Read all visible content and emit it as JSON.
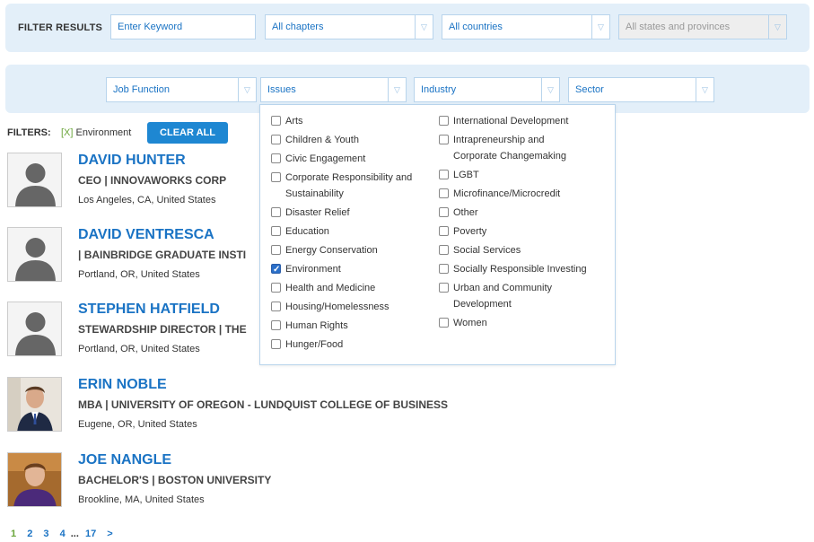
{
  "filter_bar": {
    "label": "FILTER RESULTS",
    "keyword_placeholder": "Enter Keyword",
    "chapters": "All chapters",
    "countries": "All countries",
    "states": "All states and provinces"
  },
  "sub_filters": {
    "job_function": "Job Function",
    "issues": "Issues",
    "industry": "Industry",
    "sector": "Sector"
  },
  "issues_options_left": [
    {
      "label": "Arts",
      "checked": false
    },
    {
      "label": "Children & Youth",
      "checked": false
    },
    {
      "label": "Civic Engagement",
      "checked": false
    },
    {
      "label": "Corporate Responsibility and Sustainability",
      "checked": false
    },
    {
      "label": "Disaster Relief",
      "checked": false
    },
    {
      "label": "Education",
      "checked": false
    },
    {
      "label": "Energy Conservation",
      "checked": false
    },
    {
      "label": "Environment",
      "checked": true
    },
    {
      "label": "Health and Medicine",
      "checked": false
    },
    {
      "label": "Housing/Homelessness",
      "checked": false
    },
    {
      "label": "Human Rights",
      "checked": false
    },
    {
      "label": "Hunger/Food",
      "checked": false
    }
  ],
  "issues_options_right": [
    {
      "label": "International Development",
      "checked": false
    },
    {
      "label": "Intrapreneurship and Corporate Changemaking",
      "checked": false
    },
    {
      "label": "LGBT",
      "checked": false
    },
    {
      "label": "Microfinance/Microcredit",
      "checked": false
    },
    {
      "label": "Other",
      "checked": false
    },
    {
      "label": "Poverty",
      "checked": false
    },
    {
      "label": "Social Services",
      "checked": false
    },
    {
      "label": "Socially Responsible Investing",
      "checked": false
    },
    {
      "label": "Urban and Community Development",
      "checked": false
    },
    {
      "label": "Women",
      "checked": false
    }
  ],
  "active_filters": {
    "label": "FILTERS:",
    "x_mark": "[X]",
    "item": "Environment",
    "clear_all": "CLEAR ALL"
  },
  "people": [
    {
      "name": "DAVID HUNTER",
      "title": "CEO | INNOVAWORKS CORP",
      "location": "Los Angeles, CA, United States",
      "avatar": "placeholder"
    },
    {
      "name": "DAVID VENTRESCA",
      "title": "| BAINBRIDGE GRADUATE INSTI",
      "location": "Portland, OR, United States",
      "avatar": "placeholder"
    },
    {
      "name": "STEPHEN HATFIELD",
      "title": "STEWARDSHIP DIRECTOR | THE",
      "location": "Portland, OR, United States",
      "avatar": "placeholder"
    },
    {
      "name": "ERIN NOBLE",
      "title": "MBA | UNIVERSITY OF OREGON - LUNDQUIST COLLEGE OF BUSINESS",
      "location": "Eugene, OR, United States",
      "avatar": "photo"
    },
    {
      "name": "JOE NANGLE",
      "title": "BACHELOR'S | BOSTON UNIVERSITY",
      "location": "Brookline, MA, United States",
      "avatar": "photo"
    }
  ],
  "pagination": {
    "pages": [
      "1",
      "2",
      "3",
      "4"
    ],
    "ellipsis": "...",
    "last": "17",
    "next": ">",
    "current": "1"
  },
  "colors": {
    "accent": "#1a73c4",
    "panel_bg": "#e3eff9",
    "button": "#1e87d2",
    "current_page": "#6aa53a"
  }
}
